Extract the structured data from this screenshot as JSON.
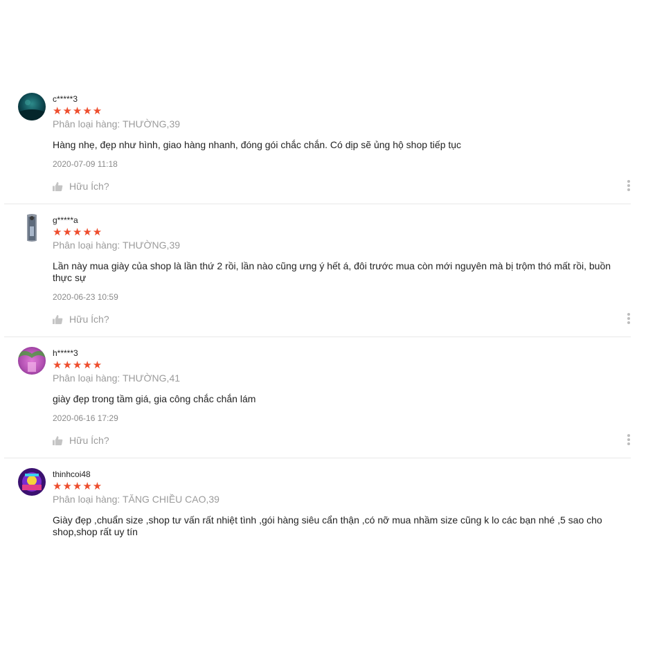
{
  "reviews": [
    {
      "username": "c*****3",
      "stars": "★★★★★",
      "rating": 5,
      "variation": "Phân loại hàng: THƯỜNG,39",
      "comment": "Hàng nhẹ, đẹp như hình, giao hàng nhanh, đóng gói chắc chắn. Có dịp sẽ ủng hộ shop tiếp tục",
      "time": "2020-07-09 11:18",
      "like_label": "Hữu Ích?"
    },
    {
      "username": "g*****a",
      "stars": "★★★★★",
      "rating": 5,
      "variation": "Phân loại hàng: THƯỜNG,39",
      "comment": "Lần này mua giày của shop là lần thứ 2 rồi, lần nào cũng ưng ý hết á, đôi trước mua còn mới nguyên mà bị trộm thó mất rồi, buồn thực sự",
      "time": "2020-06-23 10:59",
      "like_label": "Hữu Ích?"
    },
    {
      "username": "h*****3",
      "stars": "★★★★★",
      "rating": 5,
      "variation": "Phân loại hàng: THƯỜNG,41",
      "comment": "giày đẹp trong tầm giá, gia công chắc chắn lám",
      "time": "2020-06-16 17:29",
      "like_label": "Hữu Ích?"
    },
    {
      "username": "thinhcoi48",
      "stars": "★★★★★",
      "rating": 5,
      "variation": "Phân loại hàng: TĂNG CHIỀU CAO,39",
      "comment": "Giày đẹp ,chuẩn size ,shop tư vấn rất nhiệt tình ,gói hàng siêu cẩn thận ,có nỡ mua nhầm size cũng k lo các bạn nhé ,5 sao cho shop,shop rất uy tín"
    }
  ],
  "colors": {
    "star": "#ee4d2d",
    "muted": "#9b9b9b",
    "divider": "#e8e8e8"
  },
  "icons": {
    "like": "thumbs-up-icon",
    "more": "more-vertical-icon"
  }
}
